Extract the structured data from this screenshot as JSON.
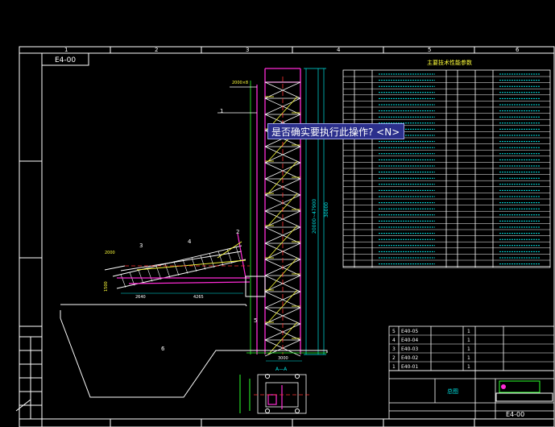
{
  "prompt": {
    "text": "是否确实要执行此操作? <N>"
  },
  "frame": {
    "columns": [
      "1",
      "2",
      "3",
      "4",
      "5",
      "6"
    ],
    "drawing_no_top": "E4-00",
    "drawing_no_bottom": "E4-00"
  },
  "tech_table": {
    "title": "主要技术性能参数"
  },
  "dims": {
    "d1": "3000",
    "d2": "2000×8",
    "d3": "1500",
    "d4": "2640",
    "d5": "4265",
    "d6": "20000~47900",
    "d7": "30000",
    "d8": "2000",
    "d9": "2000×6",
    "section": "A—A"
  },
  "callouts": [
    "1",
    "2",
    "3",
    "4",
    "5",
    "6"
  ],
  "parts_list": {
    "rows": [
      {
        "no": "5",
        "code": "E40-05",
        "qty": "1"
      },
      {
        "no": "4",
        "code": "E40-04",
        "qty": "1"
      },
      {
        "no": "3",
        "code": "E40-03",
        "qty": "1"
      },
      {
        "no": "2",
        "code": "E40-02",
        "qty": "1"
      },
      {
        "no": "1",
        "code": "E40-01",
        "qty": "1"
      }
    ]
  },
  "title_block": {
    "name": "总图",
    "code": "E4-00"
  },
  "colors": {
    "frame": "#ffffff",
    "cyan": "#00e5e5",
    "magenta": "#ff2bd6",
    "yellow": "#ffff3a",
    "red": "#ff3030",
    "green": "#2cff2c"
  }
}
